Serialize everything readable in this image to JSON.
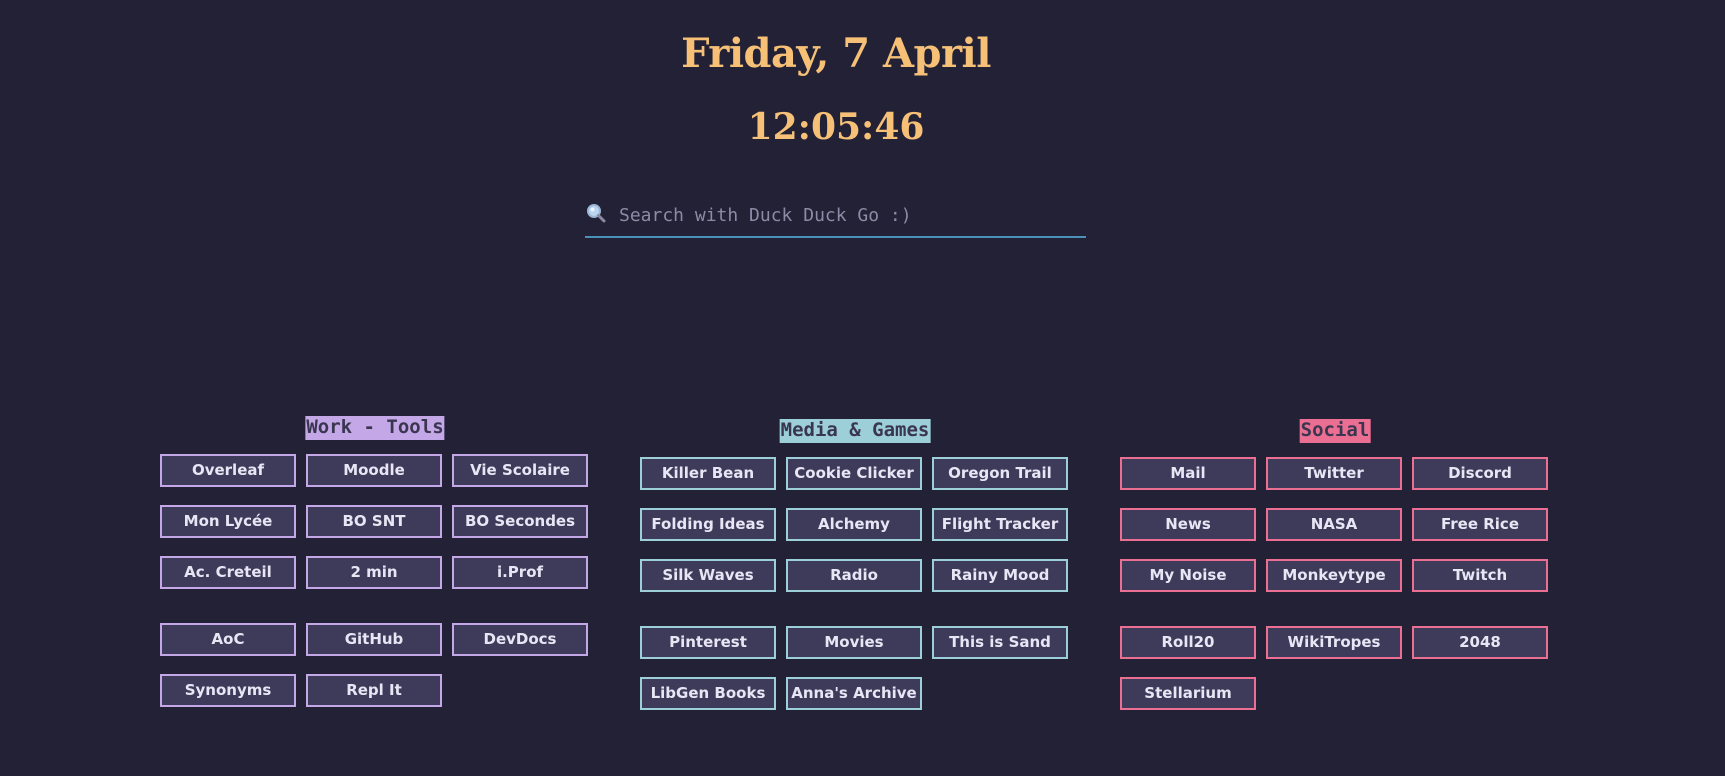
{
  "header": {
    "date": "Friday, 7 April",
    "time": "12:05:46"
  },
  "search": {
    "icon": "magnifier-icon",
    "placeholder": "Search with Duck Duck Go :)"
  },
  "colors": {
    "background": "#232136",
    "accent_gold": "#f6c177",
    "work": "#c4a7e7",
    "media": "#9ccfd8",
    "social": "#eb6f92",
    "button_fill": "#3e3a5a"
  },
  "groups": {
    "work": {
      "title": "Work - Tools",
      "links": [
        "Overleaf",
        "Moodle",
        "Vie Scolaire",
        "Mon Lycée",
        "BO SNT",
        "BO Secondes",
        "Ac. Creteil",
        "2 min",
        "i.Prof",
        "AoC",
        "GitHub",
        "DevDocs",
        "Synonyms",
        "Repl It"
      ]
    },
    "media": {
      "title": "Media & Games",
      "links": [
        "Killer Bean",
        "Cookie Clicker",
        "Oregon Trail",
        "Folding Ideas",
        "Alchemy",
        "Flight Tracker",
        "Silk Waves",
        "Radio",
        "Rainy Mood",
        "Pinterest",
        "Movies",
        "This is Sand",
        "LibGen Books",
        "Anna's Archive"
      ]
    },
    "social": {
      "title": "Social",
      "links": [
        "Mail",
        "Twitter",
        "Discord",
        "News",
        "NASA",
        "Free Rice",
        "My Noise",
        "Monkeytype",
        "Twitch",
        "Roll20",
        "WikiTropes",
        "2048",
        "Stellarium"
      ]
    }
  }
}
